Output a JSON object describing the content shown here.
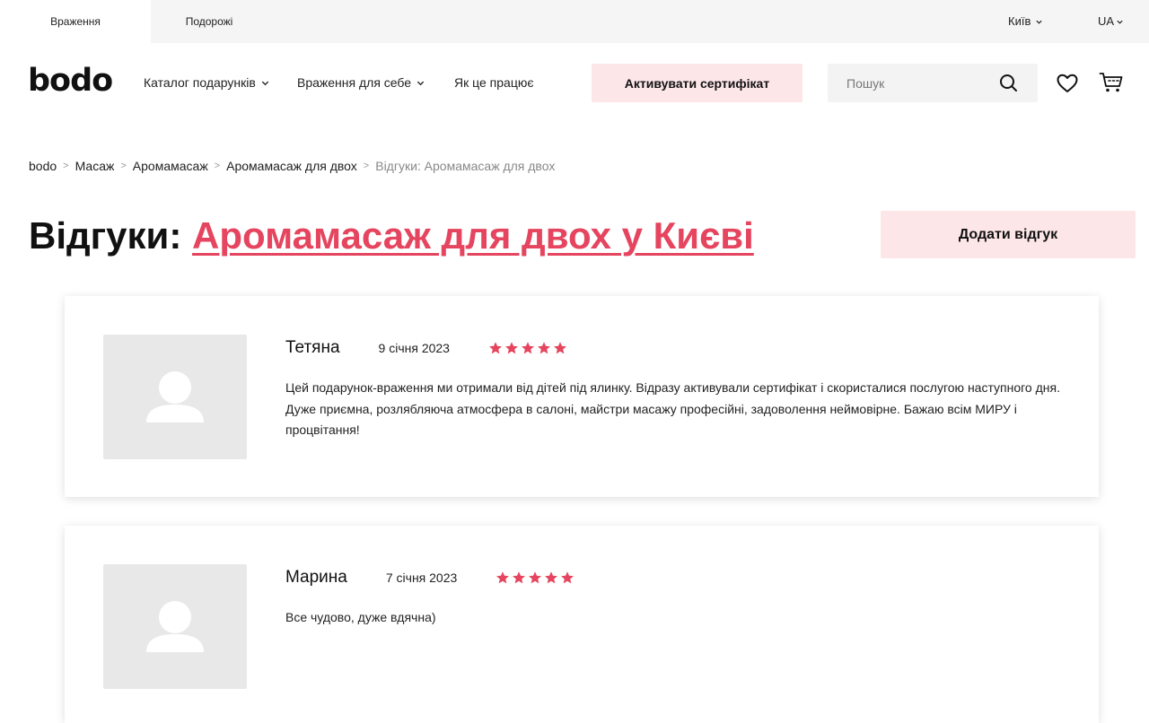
{
  "topbar": {
    "tabs": [
      {
        "label": "Враження",
        "active": true
      },
      {
        "label": "Подорожі",
        "active": false
      }
    ],
    "city": "Київ",
    "language": "UA"
  },
  "header": {
    "logo": "bodo",
    "nav": [
      {
        "label": "Каталог подарунків",
        "dropdown": true
      },
      {
        "label": "Враження для себе",
        "dropdown": true
      },
      {
        "label": "Як це працює",
        "dropdown": false
      }
    ],
    "activate_label": "Активувати сертифікат",
    "search_placeholder": "Пошук",
    "icons": [
      "search-icon",
      "heart-icon",
      "cart-icon"
    ]
  },
  "breadcrumb": [
    "bodo",
    "Масаж",
    "Аромамасаж",
    "Аромамасаж для двох",
    "Відгуки: Аромамасаж для двох"
  ],
  "page": {
    "title_prefix": "Відгуки:",
    "title_link": "Аромамасаж для двох у Києві",
    "add_review_label": "Додати відгук"
  },
  "reviews": [
    {
      "name": "Тетяна",
      "date": "9 січня 2023",
      "rating": 5,
      "text": "Цей подарунок-враження ми отримали від дітей під ялинку. Відразу активували сертифікат і скористалися послугою наступного дня. Дуже приємна, розлябляюча атмосфера в салоні, майстри масажу професійні, задоволення неймовірне. Бажаю всім МИРУ і процвітання!"
    },
    {
      "name": "Марина",
      "date": "7 січня 2023",
      "rating": 5,
      "text": "Все чудово, дуже вдячна)"
    }
  ],
  "colors": {
    "accent": "#e5455e",
    "button_bg": "#fde6e8",
    "topbar_bg": "#f5f5f5",
    "search_bg": "#f3f3f3",
    "avatar_bg": "#e8e8e8"
  }
}
